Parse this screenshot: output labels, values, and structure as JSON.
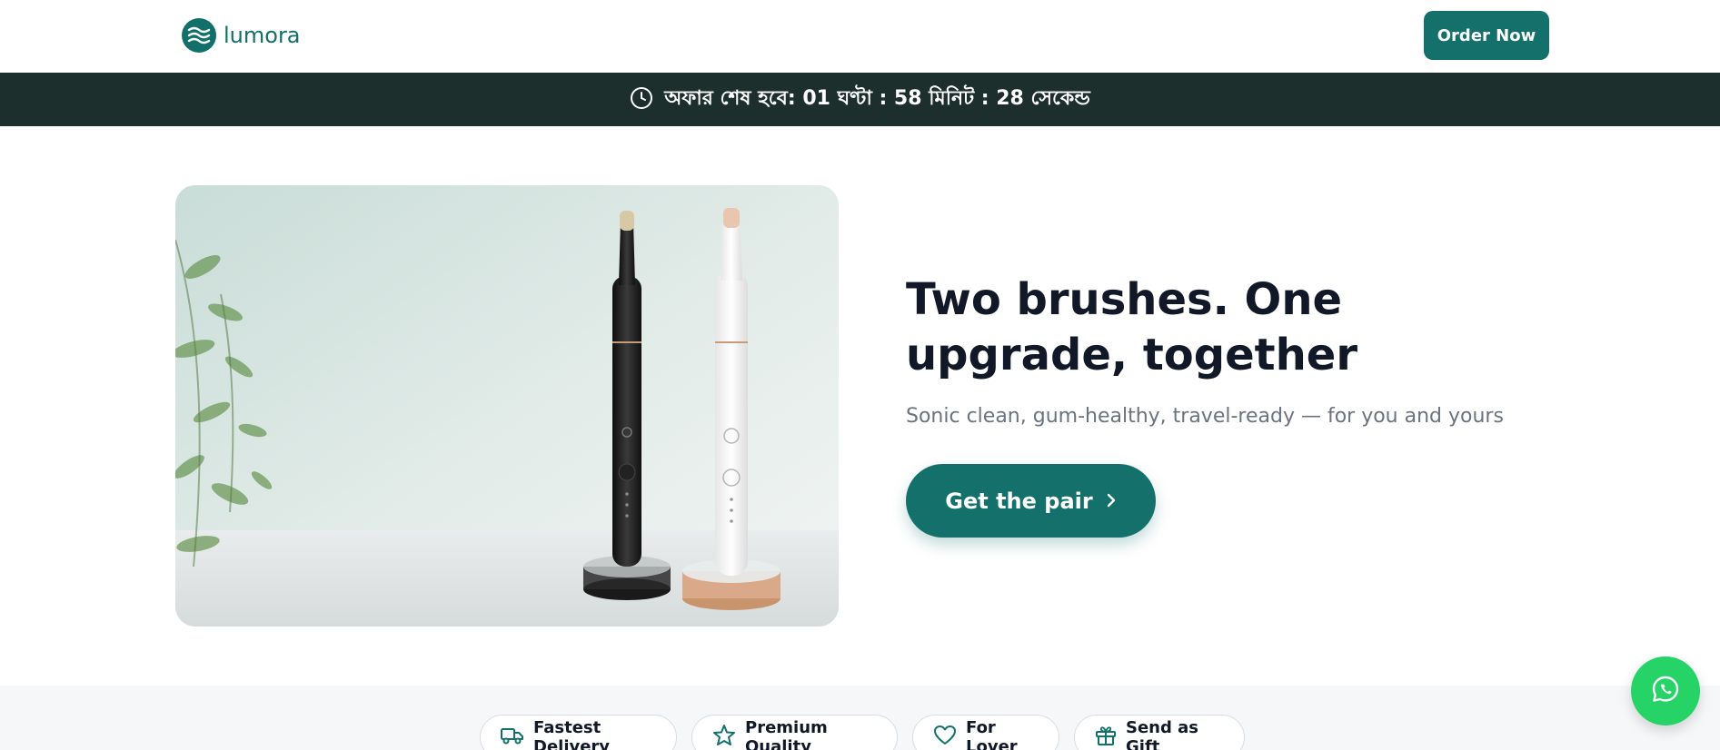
{
  "header": {
    "brand": "lumora",
    "order_button": "Order Now"
  },
  "offer_bar": {
    "text": "অফার শেষ হবে: 01 ঘণ্টা : 58 মিনিট : 28 সেকেন্ড"
  },
  "hero": {
    "title": "Two brushes. One upgrade, together",
    "subtitle": "Sonic clean, gum-healthy, travel-ready — for you and yours",
    "cta_label": "Get the pair"
  },
  "features": [
    {
      "label": "Fastest Delivery",
      "icon": "truck-icon"
    },
    {
      "label": "Premium Quality",
      "icon": "star-icon"
    },
    {
      "label": "For Lover",
      "icon": "heart-icon"
    },
    {
      "label": "Send as Gift",
      "icon": "gift-icon"
    }
  ],
  "colors": {
    "brand": "#14706a",
    "offer_bar_bg": "#1c2f2c",
    "whatsapp": "#25d366"
  }
}
